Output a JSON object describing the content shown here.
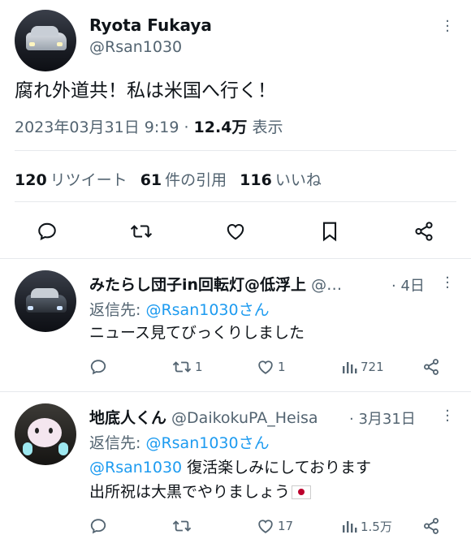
{
  "main": {
    "author_name": "Ryota Fukaya",
    "author_handle": "@Rsan1030",
    "text": "腐れ外道共！私は米国へ行く！",
    "date": "2023年03月31日 9:19 · ",
    "views_count": "12.4万",
    "views_label": " 表示",
    "retweets_count": "120",
    "retweets_label": "リツイート",
    "quotes_count": "61",
    "quotes_label": "件の引用",
    "likes_count": "116",
    "likes_label": "いいね",
    "icons": [
      "reply-icon",
      "retweet-icon",
      "like-icon",
      "bookmark-icon",
      "share-icon"
    ]
  },
  "replies": [
    {
      "name": "みたらし団子in回転灯@低浮上",
      "handle": " @…",
      "time": "· 4日",
      "replying_label": "返信先: ",
      "replying_to": "@Rsan1030さん",
      "text": "ニュース見てびっくりしました",
      "reply_count": "",
      "retweet_count": "1",
      "like_count": "1",
      "view_count": "721"
    },
    {
      "name": "地底人くん",
      "handle": " @DaikokuPA_Heisa",
      "time": "· 3月31日",
      "replying_label": "返信先: ",
      "replying_to": "@Rsan1030さん",
      "mention": "@Rsan1030",
      "text_line1": " 復活楽しみにしております",
      "text_line2": "出所祝は大黒でやりましょう",
      "reply_count": "",
      "retweet_count": "",
      "like_count": "17",
      "view_count": "1.5万"
    }
  ],
  "colors": {
    "accent": "#1d9bf0",
    "secondary": "#536471",
    "divider": "#e6e9ec"
  }
}
